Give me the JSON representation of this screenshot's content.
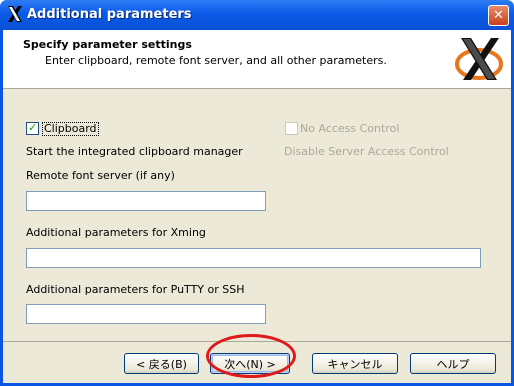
{
  "window": {
    "title": "Additional parameters",
    "close_glyph": "✕"
  },
  "header": {
    "title": "Specify parameter settings",
    "subtitle": "Enter clipboard, remote font server, and all other parameters."
  },
  "options": {
    "clipboard": {
      "label": "Clipboard",
      "checked": true,
      "description": "Start the integrated clipboard manager"
    },
    "no_access_control": {
      "label": "No Access Control",
      "checked": false,
      "enabled": false,
      "description": "Disable Server Access Control"
    }
  },
  "fields": {
    "remote_font_server": {
      "label": "Remote font server (if any)",
      "value": ""
    },
    "xming_params": {
      "label": "Additional parameters for Xming",
      "value": ""
    },
    "putty_params": {
      "label": "Additional parameters for PuTTY or SSH",
      "value": ""
    }
  },
  "buttons": {
    "back": "< 戻る(B)",
    "next": "次へ(N) >",
    "cancel": "キャンセル",
    "help": "ヘルプ"
  },
  "icons": {
    "title_icon": "xming-logo-icon",
    "header_logo": "xming-logo-icon",
    "close": "close-icon"
  },
  "colors": {
    "titlebar": "#0b5ae8",
    "annotation": "#e01a1a",
    "logo_orange": "#e8761c"
  }
}
